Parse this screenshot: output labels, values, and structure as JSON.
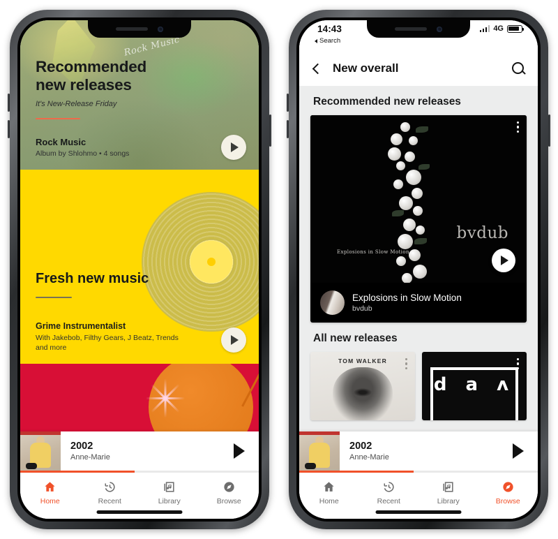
{
  "left_phone": {
    "hero_green": {
      "title_line1": "Recommended",
      "title_line2": "new releases",
      "subtitle": "It's New-Release Friday",
      "artwork_watermark": "Rock Music",
      "item_title": "Rock Music",
      "item_meta": "Album by Shlohmo • 4 songs",
      "play_icon": "play-icon",
      "accent_color": "#ef6a4a",
      "background_color": "#93a373"
    },
    "hero_yellow": {
      "title": "Fresh new music",
      "item_title": "Grime Instrumentalist",
      "item_meta": "With Jakebob, Filthy Gears, J Beatz, Trends and more",
      "play_icon": "play-icon",
      "background_color": "#ffd900"
    },
    "hero_red": {
      "background_color": "#d80f36",
      "accent_color": "#e07818"
    },
    "mini_player": {
      "track_title": "2002",
      "artist": "Anne-Marie",
      "play_icon": "play-icon",
      "progress_percent": 48,
      "progress_color": "#f0512a"
    },
    "tabbar": {
      "active": "Home",
      "active_color": "#f0512a",
      "items": [
        {
          "label": "Home",
          "icon": "home-icon"
        },
        {
          "label": "Recent",
          "icon": "history-clock-icon"
        },
        {
          "label": "Library",
          "icon": "library-music-icon"
        },
        {
          "label": "Browse",
          "icon": "compass-icon"
        }
      ]
    }
  },
  "right_phone": {
    "statusbar": {
      "time": "14:43",
      "back_label": "Search",
      "network": "4G",
      "signal_icon": "signal-bars-icon",
      "battery_icon": "battery-icon"
    },
    "appbar": {
      "back_icon": "chevron-left-icon",
      "title": "New overall",
      "search_icon": "search-icon"
    },
    "sections": [
      {
        "heading": "Recommended new releases"
      },
      {
        "heading": "All new releases"
      }
    ],
    "featured_card": {
      "artwork_title": "Explosions in Slow Motion",
      "artwork_artist_watermark": "bvdub",
      "title": "Explosions in Slow Motion",
      "artist": "bvdub",
      "play_icon": "play-icon",
      "overflow_icon": "more-vertical-icon"
    },
    "tiles": [
      {
        "name": "TOM WALKER",
        "overflow_icon": "more-vertical-icon"
      },
      {
        "letters": "d a ʌ",
        "overflow_icon": "more-vertical-icon"
      }
    ],
    "mini_player": {
      "track_title": "2002",
      "artist": "Anne-Marie",
      "play_icon": "play-icon",
      "progress_percent": 48,
      "progress_color": "#f0512a"
    },
    "tabbar": {
      "active": "Browse",
      "active_color": "#f0512a",
      "items": [
        {
          "label": "Home",
          "icon": "home-icon"
        },
        {
          "label": "Recent",
          "icon": "history-clock-icon"
        },
        {
          "label": "Library",
          "icon": "library-music-icon"
        },
        {
          "label": "Browse",
          "icon": "compass-icon"
        }
      ]
    }
  }
}
